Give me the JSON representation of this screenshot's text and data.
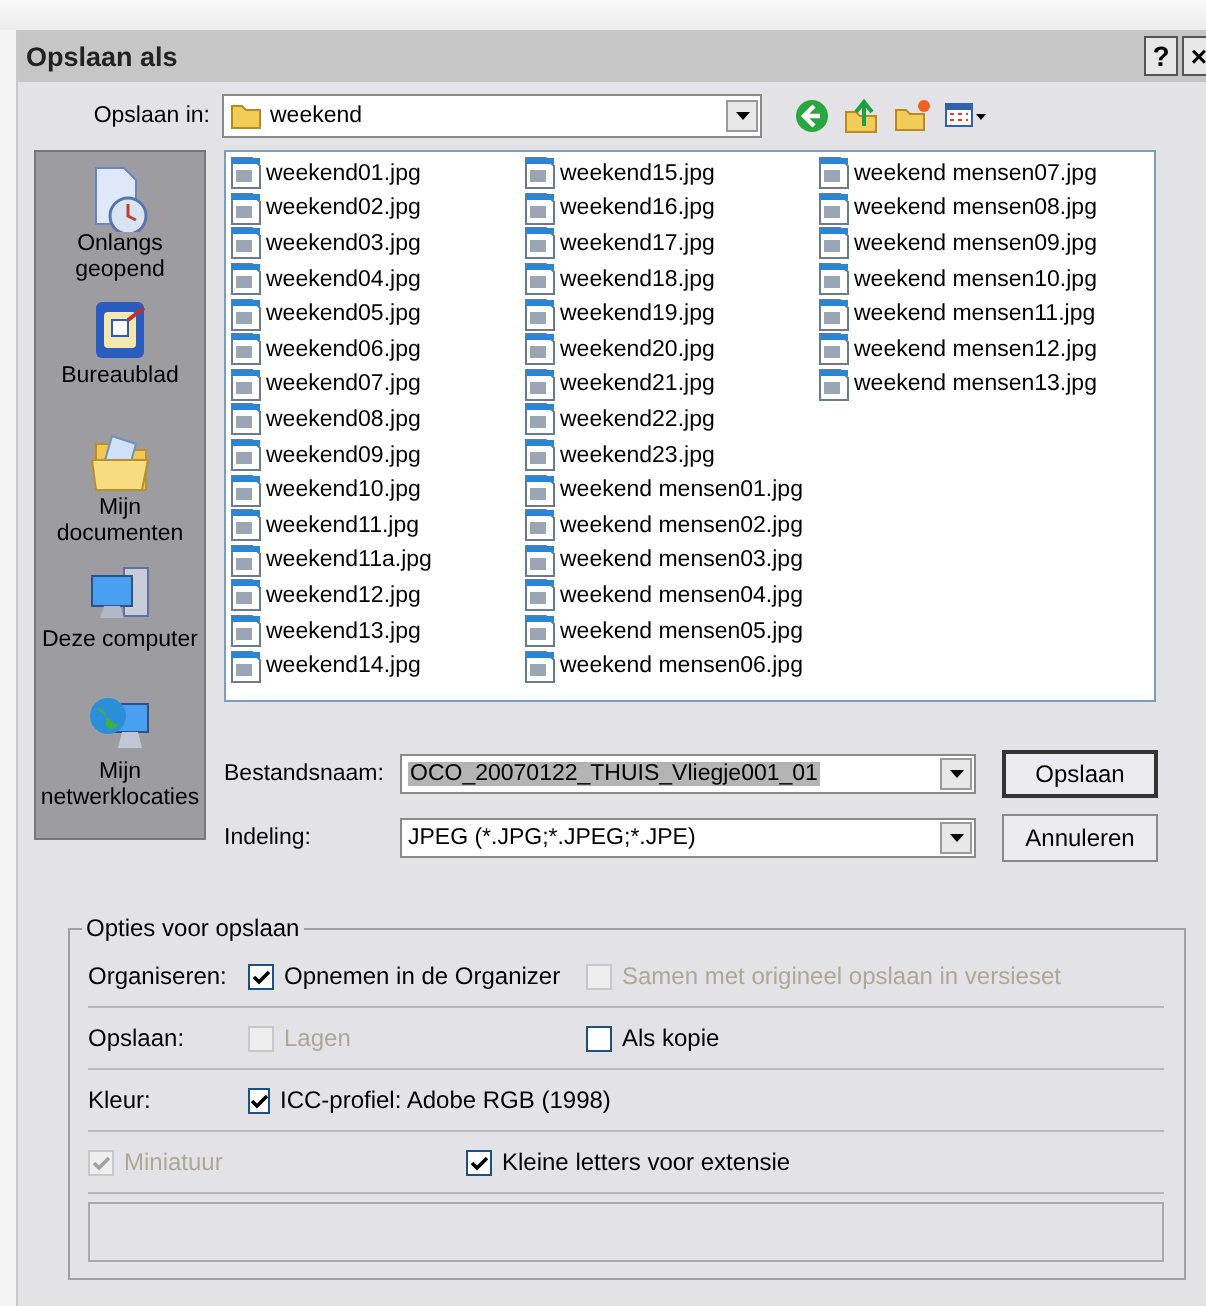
{
  "window": {
    "title": "Opslaan als",
    "buttons": [
      "?",
      "×"
    ]
  },
  "location": {
    "label": "Opslaan in:",
    "value": "weekend"
  },
  "places": [
    {
      "label": "Onlangs geopend",
      "kind": "recent"
    },
    {
      "label": "Bureaublad",
      "kind": "desktop"
    },
    {
      "label": "Mijn documenten",
      "kind": "documents"
    },
    {
      "label": "Deze computer",
      "kind": "computer"
    },
    {
      "label": "Mijn netwerklocaties",
      "kind": "network"
    }
  ],
  "files": [
    "weekend01.jpg",
    "weekend02.jpg",
    "weekend03.jpg",
    "weekend04.jpg",
    "weekend05.jpg",
    "weekend06.jpg",
    "weekend07.jpg",
    "weekend08.jpg",
    "weekend09.jpg",
    "weekend10.jpg",
    "weekend11.jpg",
    "weekend11a.jpg",
    "weekend12.jpg",
    "weekend13.jpg",
    "weekend14.jpg",
    "weekend15.jpg",
    "weekend16.jpg",
    "weekend17.jpg",
    "weekend18.jpg",
    "weekend19.jpg",
    "weekend20.jpg",
    "weekend21.jpg",
    "weekend22.jpg",
    "weekend23.jpg",
    "weekend mensen01.jpg",
    "weekend mensen02.jpg",
    "weekend mensen03.jpg",
    "weekend mensen04.jpg",
    "weekend mensen05.jpg",
    "weekend mensen06.jpg",
    "weekend mensen07.jpg",
    "weekend mensen08.jpg",
    "weekend mensen09.jpg",
    "weekend mensen10.jpg",
    "weekend mensen11.jpg",
    "weekend mensen12.jpg",
    "weekend mensen13.jpg"
  ],
  "file_name": {
    "label": "Bestandsnaam:",
    "value": "OCO_20070122_THUIS_Vliegje001_01",
    "selected": true
  },
  "format": {
    "label": "Indeling:",
    "value": "JPEG (*.JPG;*.JPEG;*.JPE)"
  },
  "buttons": [
    {
      "label": "Opslaan",
      "default": true
    },
    {
      "label": "Annuleren",
      "default": false
    }
  ],
  "options": {
    "title": "Opties voor opslaan",
    "rows": [
      {
        "label": "Organiseren:",
        "checks": [
          {
            "label": "Opnemen in de Organizer",
            "checked": true,
            "disabled": false
          },
          {
            "label": "Samen met origineel opslaan in versieset",
            "checked": false,
            "disabled": true
          }
        ]
      },
      {
        "label": "Opslaan:",
        "checks": [
          {
            "label": "Lagen",
            "checked": false,
            "disabled": true
          },
          {
            "label": "Als kopie",
            "checked": false,
            "disabled": false
          }
        ]
      },
      {
        "label": "Kleur:",
        "checks": [
          {
            "label": "ICC-profiel:  Adobe RGB (1998)",
            "checked": true,
            "disabled": false
          }
        ]
      },
      {
        "checks": [
          {
            "label": "Miniatuur",
            "checked": true,
            "disabled": true
          },
          {
            "label": "Kleine letters voor extensie",
            "checked": true,
            "disabled": false
          }
        ]
      }
    ]
  }
}
